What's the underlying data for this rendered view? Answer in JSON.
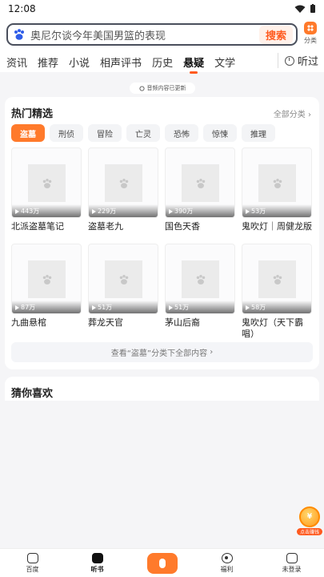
{
  "status_bar": {
    "time": "12:08"
  },
  "search": {
    "query": "奥尼尔谈今年美国男篮的表现",
    "button": "搜索"
  },
  "category_label": "分类",
  "tabs": [
    "资讯",
    "推荐",
    "小说",
    "相声评书",
    "历史",
    "悬疑",
    "文学"
  ],
  "active_tab": "悬疑",
  "listen_tab": "听过",
  "notice": "音频内容已更新",
  "hot": {
    "title": "热门精选",
    "all_categories": "全部分类",
    "chips": [
      "盗墓",
      "刑侦",
      "冒险",
      "亡灵",
      "恐怖",
      "惊悚",
      "推理"
    ],
    "active_chip": "盗墓",
    "items": [
      {
        "plays": "443万",
        "title": "北派盗墓笔记"
      },
      {
        "plays": "229万",
        "title": "盗墓老九"
      },
      {
        "plays": "390万",
        "title": "国色天香"
      },
      {
        "plays": "53万",
        "title": "鬼吹灯｜周健龙版"
      },
      {
        "plays": "87万",
        "title": "九曲悬棺"
      },
      {
        "plays": "51万",
        "title": "葬龙天官"
      },
      {
        "plays": "51万",
        "title": "茅山后裔"
      },
      {
        "plays": "58万",
        "title": "鬼吹灯（天下霸唱）"
      }
    ],
    "more": "查看“盗墓”分类下全部内容"
  },
  "guess": {
    "title": "猜你喜欢"
  },
  "float_reward": {
    "label": "点击赚钱"
  },
  "bottom_nav": {
    "items": [
      "百度",
      "听书",
      "福利",
      "未登录"
    ],
    "active": "听书"
  }
}
